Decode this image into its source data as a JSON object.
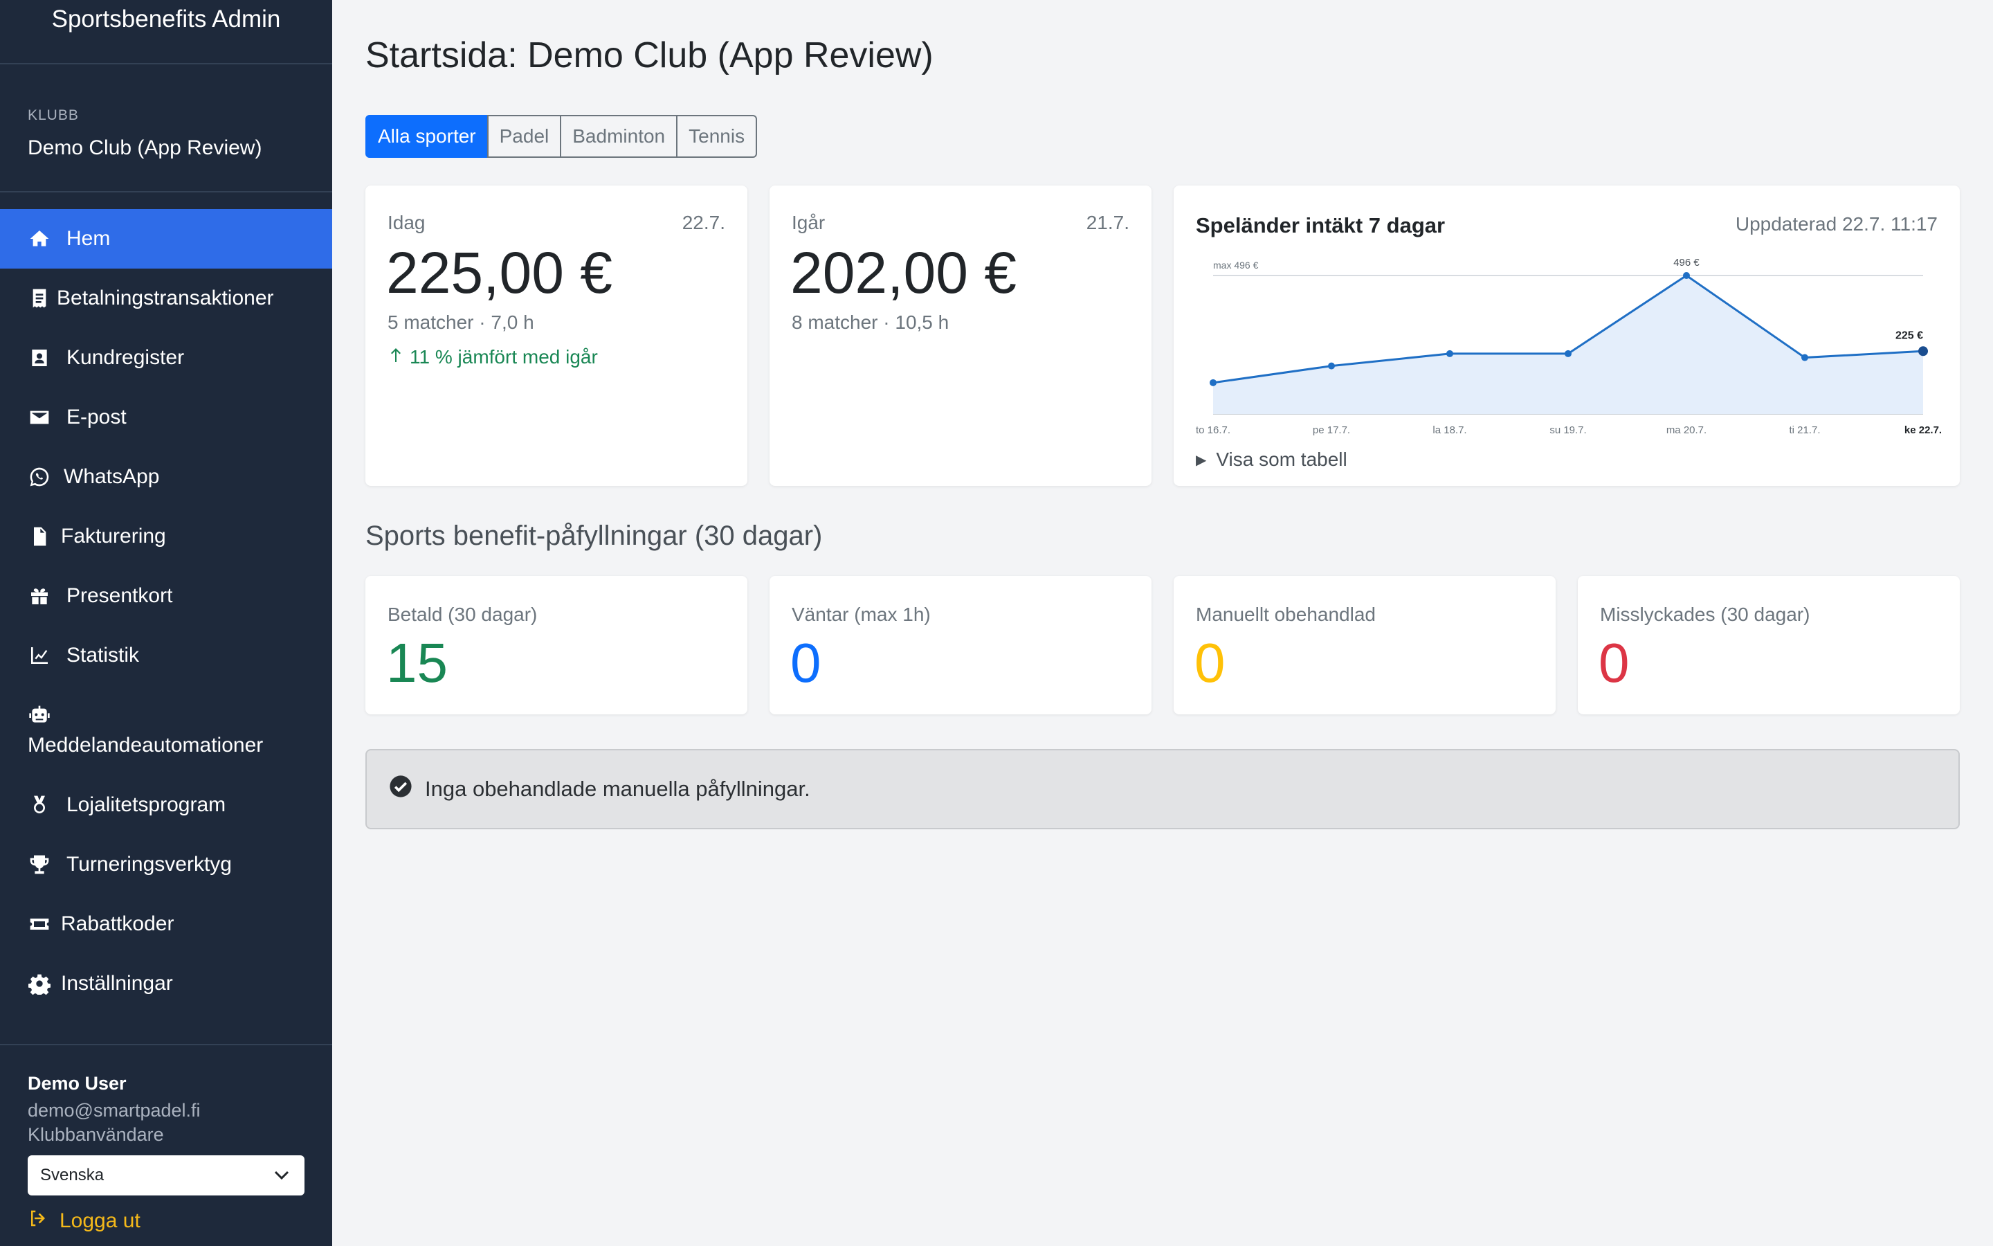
{
  "app": {
    "title": "Sportsbenefits Admin"
  },
  "club": {
    "label": "KLUBB",
    "name": "Demo Club (App Review)"
  },
  "nav": [
    {
      "label": "Hem",
      "icon": "home-icon",
      "active": true
    },
    {
      "label": "Betalningstransaktioner",
      "icon": "receipt-icon"
    },
    {
      "label": "Kundregister",
      "icon": "contact-card-icon"
    },
    {
      "label": "E-post",
      "icon": "envelope-icon"
    },
    {
      "label": "WhatsApp",
      "icon": "whatsapp-icon"
    },
    {
      "label": "Fakturering",
      "icon": "invoice-icon"
    },
    {
      "label": "Presentkort",
      "icon": "gift-icon"
    },
    {
      "label": "Statistik",
      "icon": "line-chart-icon"
    },
    {
      "label": "Meddelandeautomationer",
      "icon": "robot-icon"
    },
    {
      "label": "Lojalitetsprogram",
      "icon": "medal-icon"
    },
    {
      "label": "Turneringsverktyg",
      "icon": "trophy-icon"
    },
    {
      "label": "Rabattkoder",
      "icon": "ticket-icon"
    },
    {
      "label": "Inställningar",
      "icon": "gear-icon"
    }
  ],
  "user": {
    "name": "Demo User",
    "email": "demo@smartpadel.fi",
    "role": "Klubbanvändare",
    "language": "Svenska",
    "logout": "Logga ut"
  },
  "page": {
    "title": "Startsida: Demo Club (App Review)"
  },
  "sport_tabs": [
    "Alla sporter",
    "Padel",
    "Badminton",
    "Tennis"
  ],
  "today": {
    "label": "Idag",
    "date": "22.7.",
    "value": "225,00 €",
    "sub": "5 matcher · 7,0 h",
    "trend": "11 % jämfört med igår"
  },
  "yesterday": {
    "label": "Igår",
    "date": "21.7.",
    "value": "202,00 €",
    "sub": "8 matcher · 10,5 h"
  },
  "revenue_chart": {
    "title": "Speländer intäkt 7 dagar",
    "updated": "Uppdaterad 22.7. 11:17",
    "toggle": "Visa som tabell"
  },
  "chart_data": {
    "type": "area",
    "title": "Speländer intäkt 7 dagar",
    "categories": [
      "to 16.7.",
      "pe 17.7.",
      "la 18.7.",
      "su 19.7.",
      "ma 20.7.",
      "ti 21.7.",
      "ke 22.7."
    ],
    "values": [
      112,
      172,
      216,
      216,
      496,
      202,
      225
    ],
    "annotations": [
      "max 496 €",
      "496 €",
      "225 €"
    ],
    "ylim": [
      0,
      496
    ],
    "grid": false,
    "color": "#1f6fc5",
    "fill": "#e4eefb"
  },
  "refills": {
    "title": "Sports benefit-påfyllningar (30 dagar)",
    "stats": [
      {
        "label": "Betald (30 dagar)",
        "value": "15",
        "color": "#198754"
      },
      {
        "label": "Väntar (max 1h)",
        "value": "0",
        "color": "#0d6efd"
      },
      {
        "label": "Manuellt obehandlad",
        "value": "0",
        "color": "#ffc107"
      },
      {
        "label": "Misslyckades (30 dagar)",
        "value": "0",
        "color": "#dc3545"
      }
    ]
  },
  "alert": {
    "text": "Inga obehandlade manuella påfyllningar."
  }
}
